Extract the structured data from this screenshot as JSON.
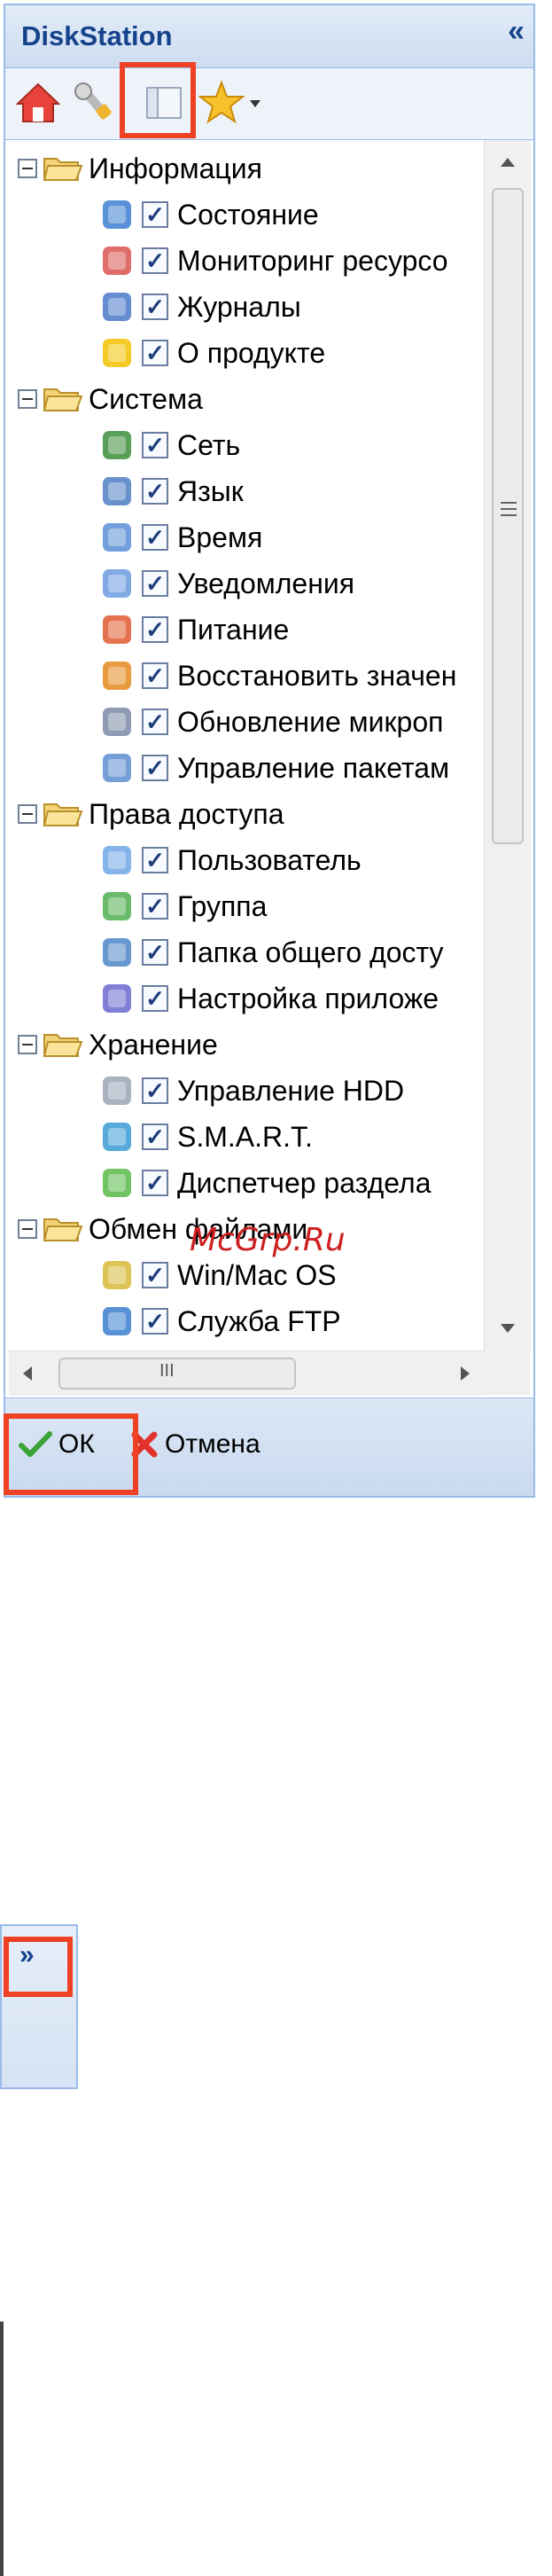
{
  "panel": {
    "title": "DiskStation",
    "collapse_label": "«"
  },
  "toolbar": {
    "home_icon": "home-icon",
    "tools_icon": "wrench-icon",
    "view_icon": "panel-view-icon",
    "favorites_icon": "star-dropdown-icon"
  },
  "tree": [
    {
      "type": "group",
      "label": "Информация"
    },
    {
      "type": "item",
      "label": "Состояние",
      "icon": "status-icon"
    },
    {
      "type": "item",
      "label": "Мониторинг ресурсо",
      "icon": "resource-monitor-icon"
    },
    {
      "type": "item",
      "label": "Журналы",
      "icon": "logs-icon"
    },
    {
      "type": "item",
      "label": "О продукте",
      "icon": "lightbulb-icon"
    },
    {
      "type": "group",
      "label": "Система"
    },
    {
      "type": "item",
      "label": "Сеть",
      "icon": "network-icon"
    },
    {
      "type": "item",
      "label": "Язык",
      "icon": "language-icon"
    },
    {
      "type": "item",
      "label": "Время",
      "icon": "clock-icon"
    },
    {
      "type": "item",
      "label": "Уведомления",
      "icon": "notification-icon"
    },
    {
      "type": "item",
      "label": "Питание",
      "icon": "power-icon"
    },
    {
      "type": "item",
      "label": "Восстановить значен",
      "icon": "restore-icon"
    },
    {
      "type": "item",
      "label": "Обновление микроп",
      "icon": "firmware-update-icon"
    },
    {
      "type": "item",
      "label": "Управление пакетам",
      "icon": "package-icon"
    },
    {
      "type": "group",
      "label": "Права доступа"
    },
    {
      "type": "item",
      "label": "Пользователь",
      "icon": "user-icon"
    },
    {
      "type": "item",
      "label": "Группа",
      "icon": "group-icon"
    },
    {
      "type": "item",
      "label": "Папка общего досту",
      "icon": "shared-folder-icon"
    },
    {
      "type": "item",
      "label": "Настройка приложе",
      "icon": "app-settings-icon"
    },
    {
      "type": "group",
      "label": "Хранение"
    },
    {
      "type": "item",
      "label": "Управление HDD",
      "icon": "hdd-icon"
    },
    {
      "type": "item",
      "label": "S.M.A.R.T.",
      "icon": "smart-icon"
    },
    {
      "type": "item",
      "label": "Диспетчер раздела",
      "icon": "partition-icon"
    },
    {
      "type": "group",
      "label": "Обмен файлами"
    },
    {
      "type": "item",
      "label": "Win/Mac OS",
      "icon": "winmac-icon"
    },
    {
      "type": "item",
      "label": "Служба FTP",
      "icon": "ftp-icon"
    }
  ],
  "checkbox_mark": "✓",
  "scroll": {
    "grip": "III"
  },
  "footer": {
    "ok_label": "ОК",
    "cancel_label": "Отмена"
  },
  "watermark": "McGrp.Ru",
  "mini_panel": {
    "expand_label": "»"
  },
  "colors": {
    "title": "#15428b",
    "border": "#99bbe8",
    "highlight": "#ef4123",
    "watermark": "#cc2020"
  }
}
